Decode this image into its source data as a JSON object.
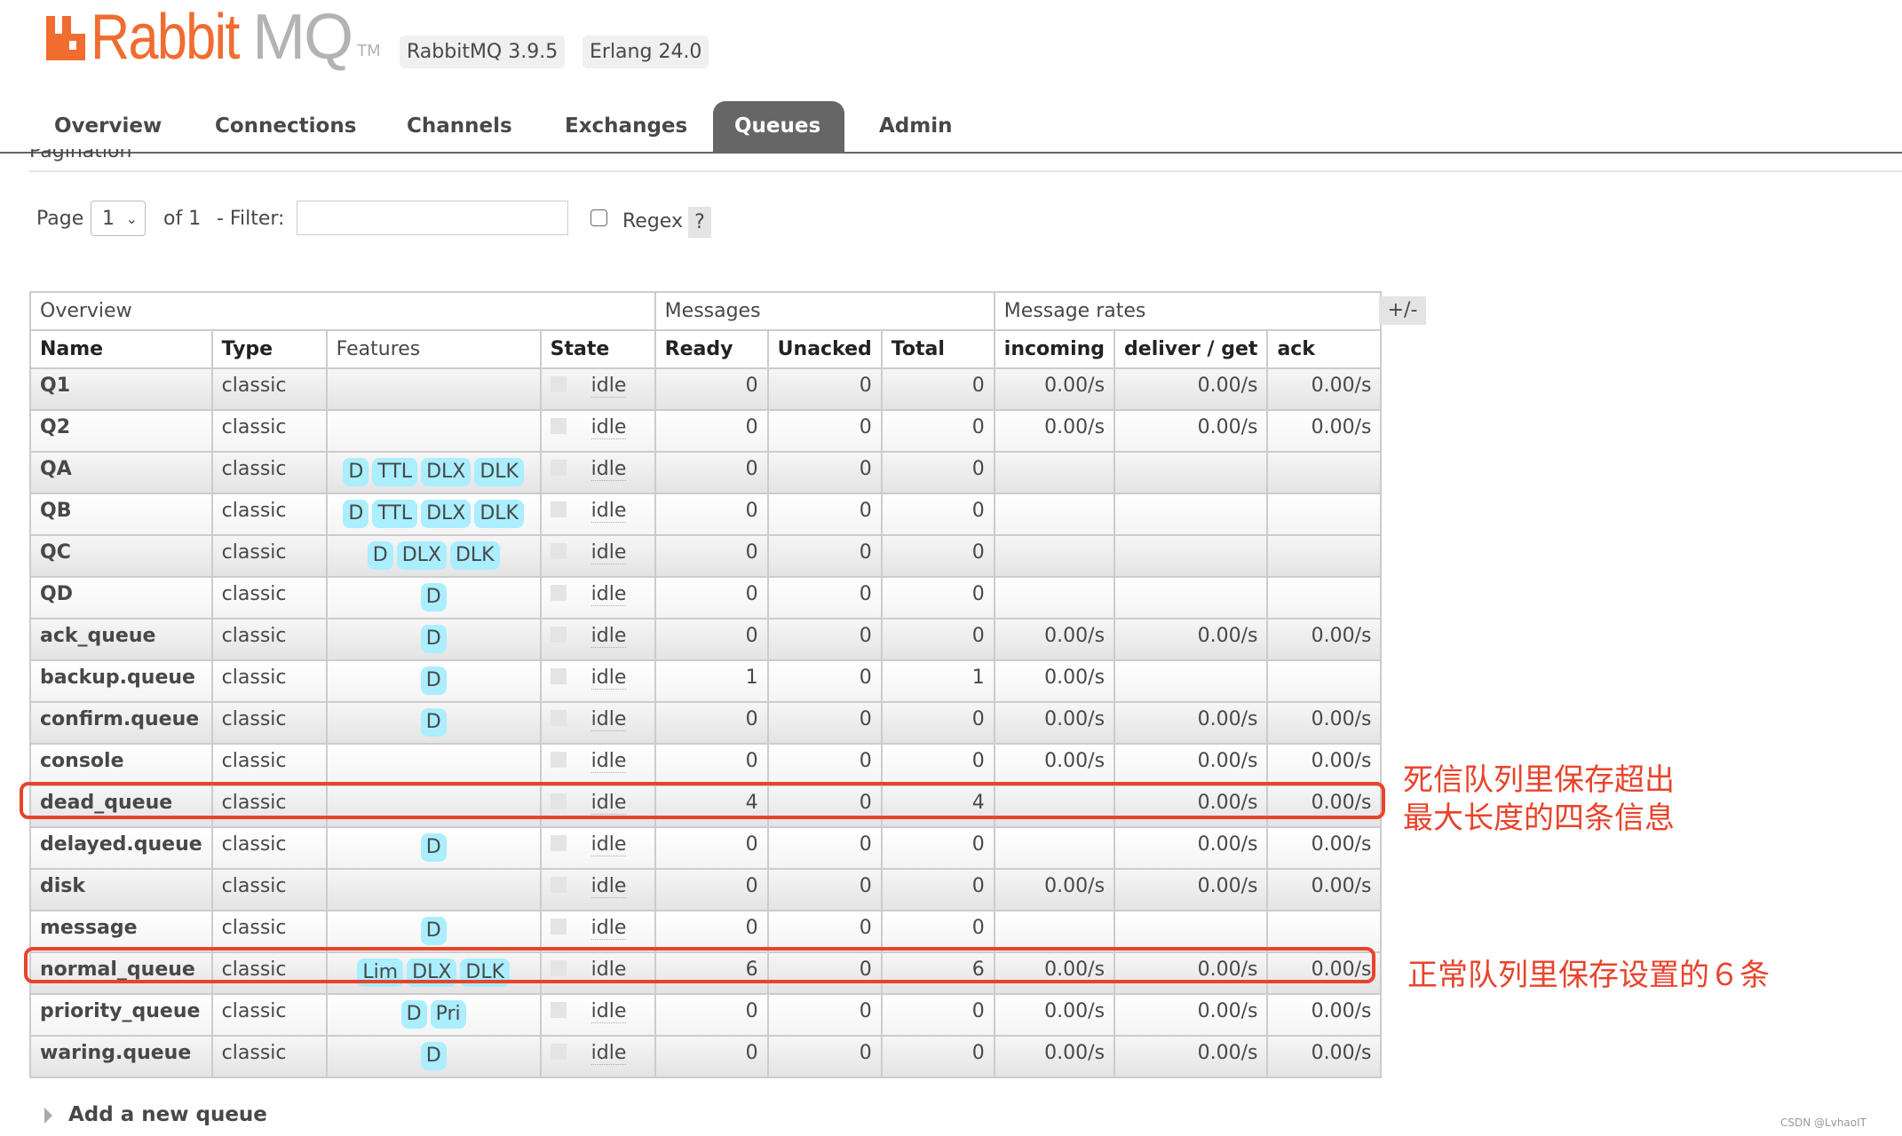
{
  "header": {
    "logo_primary": "Rabbit",
    "logo_secondary": "MQ",
    "logo_tm": "TM",
    "version_badge": "RabbitMQ 3.9.5",
    "erlang_badge": "Erlang 24.0"
  },
  "tabs": [
    {
      "label": "Overview",
      "active": false
    },
    {
      "label": "Connections",
      "active": false
    },
    {
      "label": "Channels",
      "active": false
    },
    {
      "label": "Exchanges",
      "active": false
    },
    {
      "label": "Queues",
      "active": true
    },
    {
      "label": "Admin",
      "active": false
    }
  ],
  "pagination": {
    "heading": "Pagination",
    "page_label": "Page",
    "page_value": "1",
    "of_label": "of 1",
    "filter_label": "- Filter:",
    "filter_value": "",
    "regex_label": "Regex",
    "regex_checked": false,
    "help_label": "?"
  },
  "table": {
    "group_headers": [
      "Overview",
      "Messages",
      "Message rates"
    ],
    "columns": [
      "Name",
      "Type",
      "Features",
      "State",
      "Ready",
      "Unacked",
      "Total",
      "incoming",
      "deliver / get",
      "ack"
    ],
    "toggle_columns_label": "+/-",
    "rows": [
      {
        "name": "Q1",
        "type": "classic",
        "features": [],
        "state": "idle",
        "ready": "0",
        "unacked": "0",
        "total": "0",
        "incoming": "0.00/s",
        "deliver_get": "0.00/s",
        "ack": "0.00/s"
      },
      {
        "name": "Q2",
        "type": "classic",
        "features": [],
        "state": "idle",
        "ready": "0",
        "unacked": "0",
        "total": "0",
        "incoming": "0.00/s",
        "deliver_get": "0.00/s",
        "ack": "0.00/s"
      },
      {
        "name": "QA",
        "type": "classic",
        "features": [
          "D",
          "TTL",
          "DLX",
          "DLK"
        ],
        "state": "idle",
        "ready": "0",
        "unacked": "0",
        "total": "0",
        "incoming": "",
        "deliver_get": "",
        "ack": ""
      },
      {
        "name": "QB",
        "type": "classic",
        "features": [
          "D",
          "TTL",
          "DLX",
          "DLK"
        ],
        "state": "idle",
        "ready": "0",
        "unacked": "0",
        "total": "0",
        "incoming": "",
        "deliver_get": "",
        "ack": ""
      },
      {
        "name": "QC",
        "type": "classic",
        "features": [
          "D",
          "DLX",
          "DLK"
        ],
        "state": "idle",
        "ready": "0",
        "unacked": "0",
        "total": "0",
        "incoming": "",
        "deliver_get": "",
        "ack": ""
      },
      {
        "name": "QD",
        "type": "classic",
        "features": [
          "D"
        ],
        "state": "idle",
        "ready": "0",
        "unacked": "0",
        "total": "0",
        "incoming": "",
        "deliver_get": "",
        "ack": ""
      },
      {
        "name": "ack_queue",
        "type": "classic",
        "features": [
          "D"
        ],
        "state": "idle",
        "ready": "0",
        "unacked": "0",
        "total": "0",
        "incoming": "0.00/s",
        "deliver_get": "0.00/s",
        "ack": "0.00/s"
      },
      {
        "name": "backup.queue",
        "type": "classic",
        "features": [
          "D"
        ],
        "state": "idle",
        "ready": "1",
        "unacked": "0",
        "total": "1",
        "incoming": "0.00/s",
        "deliver_get": "",
        "ack": ""
      },
      {
        "name": "confirm.queue",
        "type": "classic",
        "features": [
          "D"
        ],
        "state": "idle",
        "ready": "0",
        "unacked": "0",
        "total": "0",
        "incoming": "0.00/s",
        "deliver_get": "0.00/s",
        "ack": "0.00/s"
      },
      {
        "name": "console",
        "type": "classic",
        "features": [],
        "state": "idle",
        "ready": "0",
        "unacked": "0",
        "total": "0",
        "incoming": "0.00/s",
        "deliver_get": "0.00/s",
        "ack": "0.00/s"
      },
      {
        "name": "dead_queue",
        "type": "classic",
        "features": [],
        "state": "idle",
        "ready": "4",
        "unacked": "0",
        "total": "4",
        "incoming": "",
        "deliver_get": "0.00/s",
        "ack": "0.00/s"
      },
      {
        "name": "delayed.queue",
        "type": "classic",
        "features": [
          "D"
        ],
        "state": "idle",
        "ready": "0",
        "unacked": "0",
        "total": "0",
        "incoming": "",
        "deliver_get": "0.00/s",
        "ack": "0.00/s"
      },
      {
        "name": "disk",
        "type": "classic",
        "features": [],
        "state": "idle",
        "ready": "0",
        "unacked": "0",
        "total": "0",
        "incoming": "0.00/s",
        "deliver_get": "0.00/s",
        "ack": "0.00/s"
      },
      {
        "name": "message",
        "type": "classic",
        "features": [
          "D"
        ],
        "state": "idle",
        "ready": "0",
        "unacked": "0",
        "total": "0",
        "incoming": "",
        "deliver_get": "",
        "ack": ""
      },
      {
        "name": "normal_queue",
        "type": "classic",
        "features": [
          "Lim",
          "DLX",
          "DLK"
        ],
        "state": "idle",
        "ready": "6",
        "unacked": "0",
        "total": "6",
        "incoming": "0.00/s",
        "deliver_get": "0.00/s",
        "ack": "0.00/s"
      },
      {
        "name": "priority_queue",
        "type": "classic",
        "features": [
          "D",
          "Pri"
        ],
        "state": "idle",
        "ready": "0",
        "unacked": "0",
        "total": "0",
        "incoming": "0.00/s",
        "deliver_get": "0.00/s",
        "ack": "0.00/s"
      },
      {
        "name": "waring.queue",
        "type": "classic",
        "features": [
          "D"
        ],
        "state": "idle",
        "ready": "0",
        "unacked": "0",
        "total": "0",
        "incoming": "0.00/s",
        "deliver_get": "0.00/s",
        "ack": "0.00/s"
      }
    ]
  },
  "annotations": {
    "dead_queue_note_line1": "死信队列里保存超出",
    "dead_queue_note_line2": "最大长度的四条信息",
    "normal_queue_note": "正常队列里保存设置的６条",
    "color": "#e8432b"
  },
  "add_queue_label": "Add a new queue",
  "watermark": "CSDN @LvhaoIT",
  "colors": {
    "brand_orange": "#f06c2f",
    "active_tab": "#666666",
    "feature_badge": "#aaeeff"
  }
}
